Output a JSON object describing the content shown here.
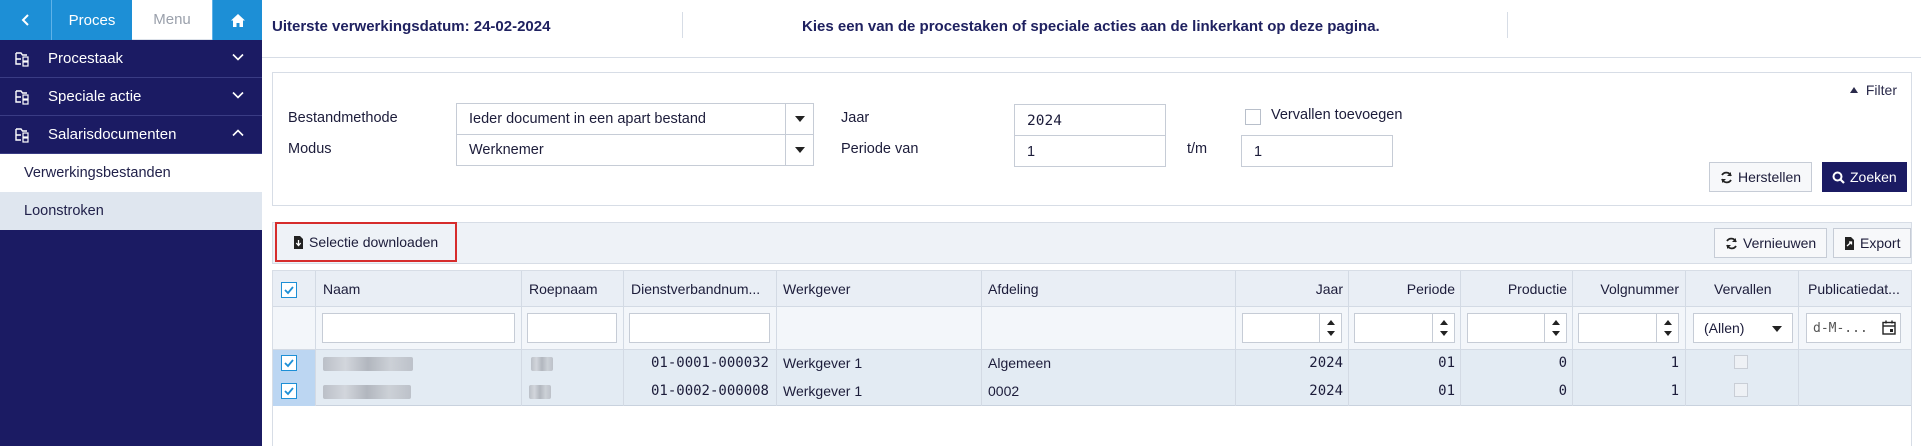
{
  "sidebar": {
    "nav": {
      "proces": "Proces",
      "menu": "Menu"
    },
    "sections": [
      {
        "label": "Procestaak",
        "expanded": false
      },
      {
        "label": "Speciale actie",
        "expanded": false
      },
      {
        "label": "Salarisdocumenten",
        "expanded": true
      }
    ],
    "subitems": [
      {
        "label": "Verwerkingsbestanden",
        "selected": false
      },
      {
        "label": "Loonstroken",
        "selected": true
      }
    ]
  },
  "header": {
    "deadline": "Uiterste verwerkingsdatum: 24-02-2024",
    "instruction": "Kies een van de procestaken of speciale acties aan de linkerkant op deze pagina."
  },
  "filter": {
    "toggle_label": "Filter",
    "bestandmethode_label": "Bestandmethode",
    "bestandmethode_value": "Ieder document in een apart bestand",
    "modus_label": "Modus",
    "modus_value": "Werknemer",
    "jaar_label": "Jaar",
    "jaar_value": "2024",
    "periode_label": "Periode van",
    "periode_from": "1",
    "tm_label": "t/m",
    "periode_to": "1",
    "vervallen_label": "Vervallen toevoegen",
    "herstellen": "Herstellen",
    "zoeken": "Zoeken"
  },
  "toolbar": {
    "selectie_downloaden": "Selectie downloaden",
    "vernieuwen": "Vernieuwen",
    "export": "Export"
  },
  "grid": {
    "columns": [
      "Naam",
      "Roepnaam",
      "Dienstverbandnum...",
      "Werkgever",
      "Afdeling",
      "Jaar",
      "Periode",
      "Productie",
      "Volgnummer",
      "Vervallen",
      "Publicatiedat..."
    ],
    "vervallen_filter": "(Allen)",
    "date_placeholder": "d-M-...",
    "rows": [
      {
        "dienstverband": "01-0001-000032",
        "werkgever": "Werkgever 1",
        "afdeling": "Algemeen",
        "jaar": "2024",
        "periode": "01",
        "productie": "0",
        "volgnummer": "1"
      },
      {
        "dienstverband": "01-0002-000008",
        "werkgever": "Werkgever 1",
        "afdeling": "0002",
        "jaar": "2024",
        "periode": "01",
        "productie": "0",
        "volgnummer": "1"
      }
    ]
  },
  "colors": {
    "navy": "#1b1b63",
    "accent_blue": "#1d8fd6",
    "highlight_red": "#d62c2c"
  }
}
